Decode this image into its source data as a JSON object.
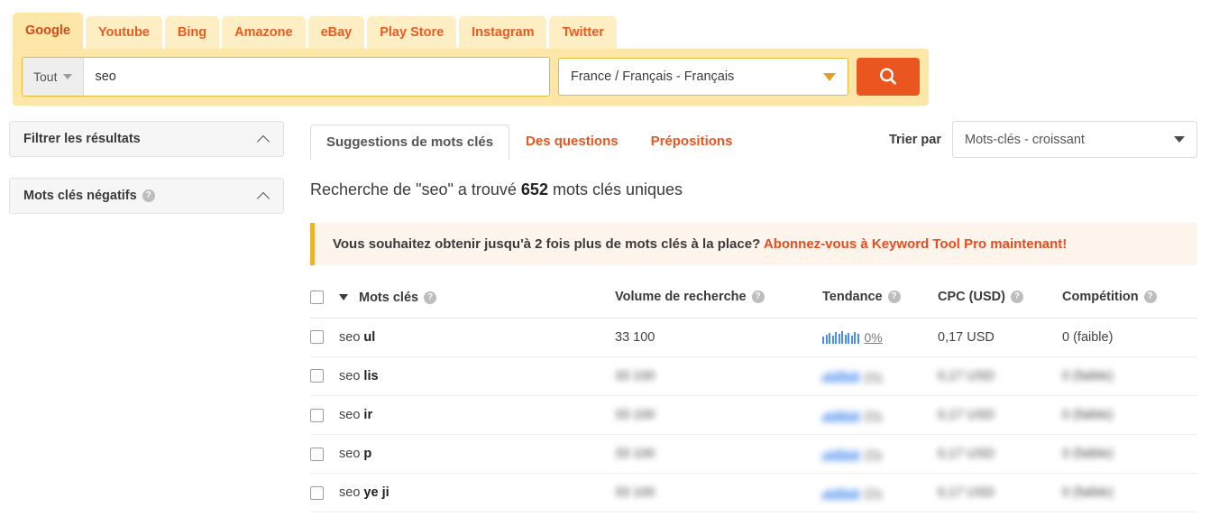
{
  "engine": {
    "tabs": [
      {
        "label": "Google",
        "active": true
      },
      {
        "label": "Youtube",
        "active": false
      },
      {
        "label": "Bing",
        "active": false
      },
      {
        "label": "Amazone",
        "active": false
      },
      {
        "label": "eBay",
        "active": false
      },
      {
        "label": "Play Store",
        "active": false
      },
      {
        "label": "Instagram",
        "active": false
      },
      {
        "label": "Twitter",
        "active": false
      }
    ],
    "scope_label": "Tout",
    "query_value": "seo",
    "query_placeholder": "",
    "country": "France / Français - Français",
    "search_icon": "search-icon",
    "accent": "#ea5520",
    "header_bg": "#fce6a8"
  },
  "sidebar": {
    "panels": [
      {
        "title": "Filtrer les résultats",
        "has_help": false,
        "chevron": "chevron-up-icon"
      },
      {
        "title": "Mots clés négatifs",
        "has_help": true,
        "chevron": "chevron-up-icon"
      }
    ]
  },
  "main": {
    "tabs": [
      {
        "label": "Suggestions de mots clés",
        "active": true
      },
      {
        "label": "Des questions",
        "active": false
      },
      {
        "label": "Prépositions",
        "active": false
      }
    ],
    "sort_label": "Trier par",
    "sort_value": "Mots-clés - croissant",
    "result_prefix": "Recherche de \"seo\" a trouvé ",
    "result_count": "652",
    "result_suffix": " mots clés uniques",
    "promo_text": "Vous souhaitez obtenir jusqu'à 2 fois plus de mots clés à la place? ",
    "promo_link": "Abonnez-vous à Keyword Tool Pro maintenant!"
  },
  "table": {
    "columns": [
      {
        "label": "Mots clés",
        "help": true,
        "sorted": true
      },
      {
        "label": "Volume de recherche",
        "help": true
      },
      {
        "label": "Tendance",
        "help": true
      },
      {
        "label": "CPC (USD)",
        "help": true
      },
      {
        "label": "Compétition",
        "help": true
      }
    ],
    "rows": [
      {
        "prefix": "seo ",
        "term": "ul",
        "volume": "33 100",
        "trend": "0%",
        "cpc": "0,17 USD",
        "competition": "0 (faible)",
        "blurred": false
      },
      {
        "prefix": "seo ",
        "term": "lis",
        "volume": "33 100",
        "trend": "0%",
        "cpc": "0,17 USD",
        "competition": "0 (faible)",
        "blurred": true
      },
      {
        "prefix": "seo ",
        "term": "ir",
        "volume": "33 100",
        "trend": "0%",
        "cpc": "0,17 USD",
        "competition": "0 (faible)",
        "blurred": true
      },
      {
        "prefix": "seo ",
        "term": "p",
        "volume": "33 100",
        "trend": "0%",
        "cpc": "0,17 USD",
        "competition": "0 (faible)",
        "blurred": true
      },
      {
        "prefix": "seo ",
        "term": "ye ji",
        "volume": "33 100",
        "trend": "0%",
        "cpc": "0,17 USD",
        "competition": "0 (faible)",
        "blurred": true
      }
    ],
    "sparkline": [
      8,
      10,
      12,
      9,
      13,
      11,
      14,
      10,
      12,
      9,
      13,
      11
    ]
  }
}
